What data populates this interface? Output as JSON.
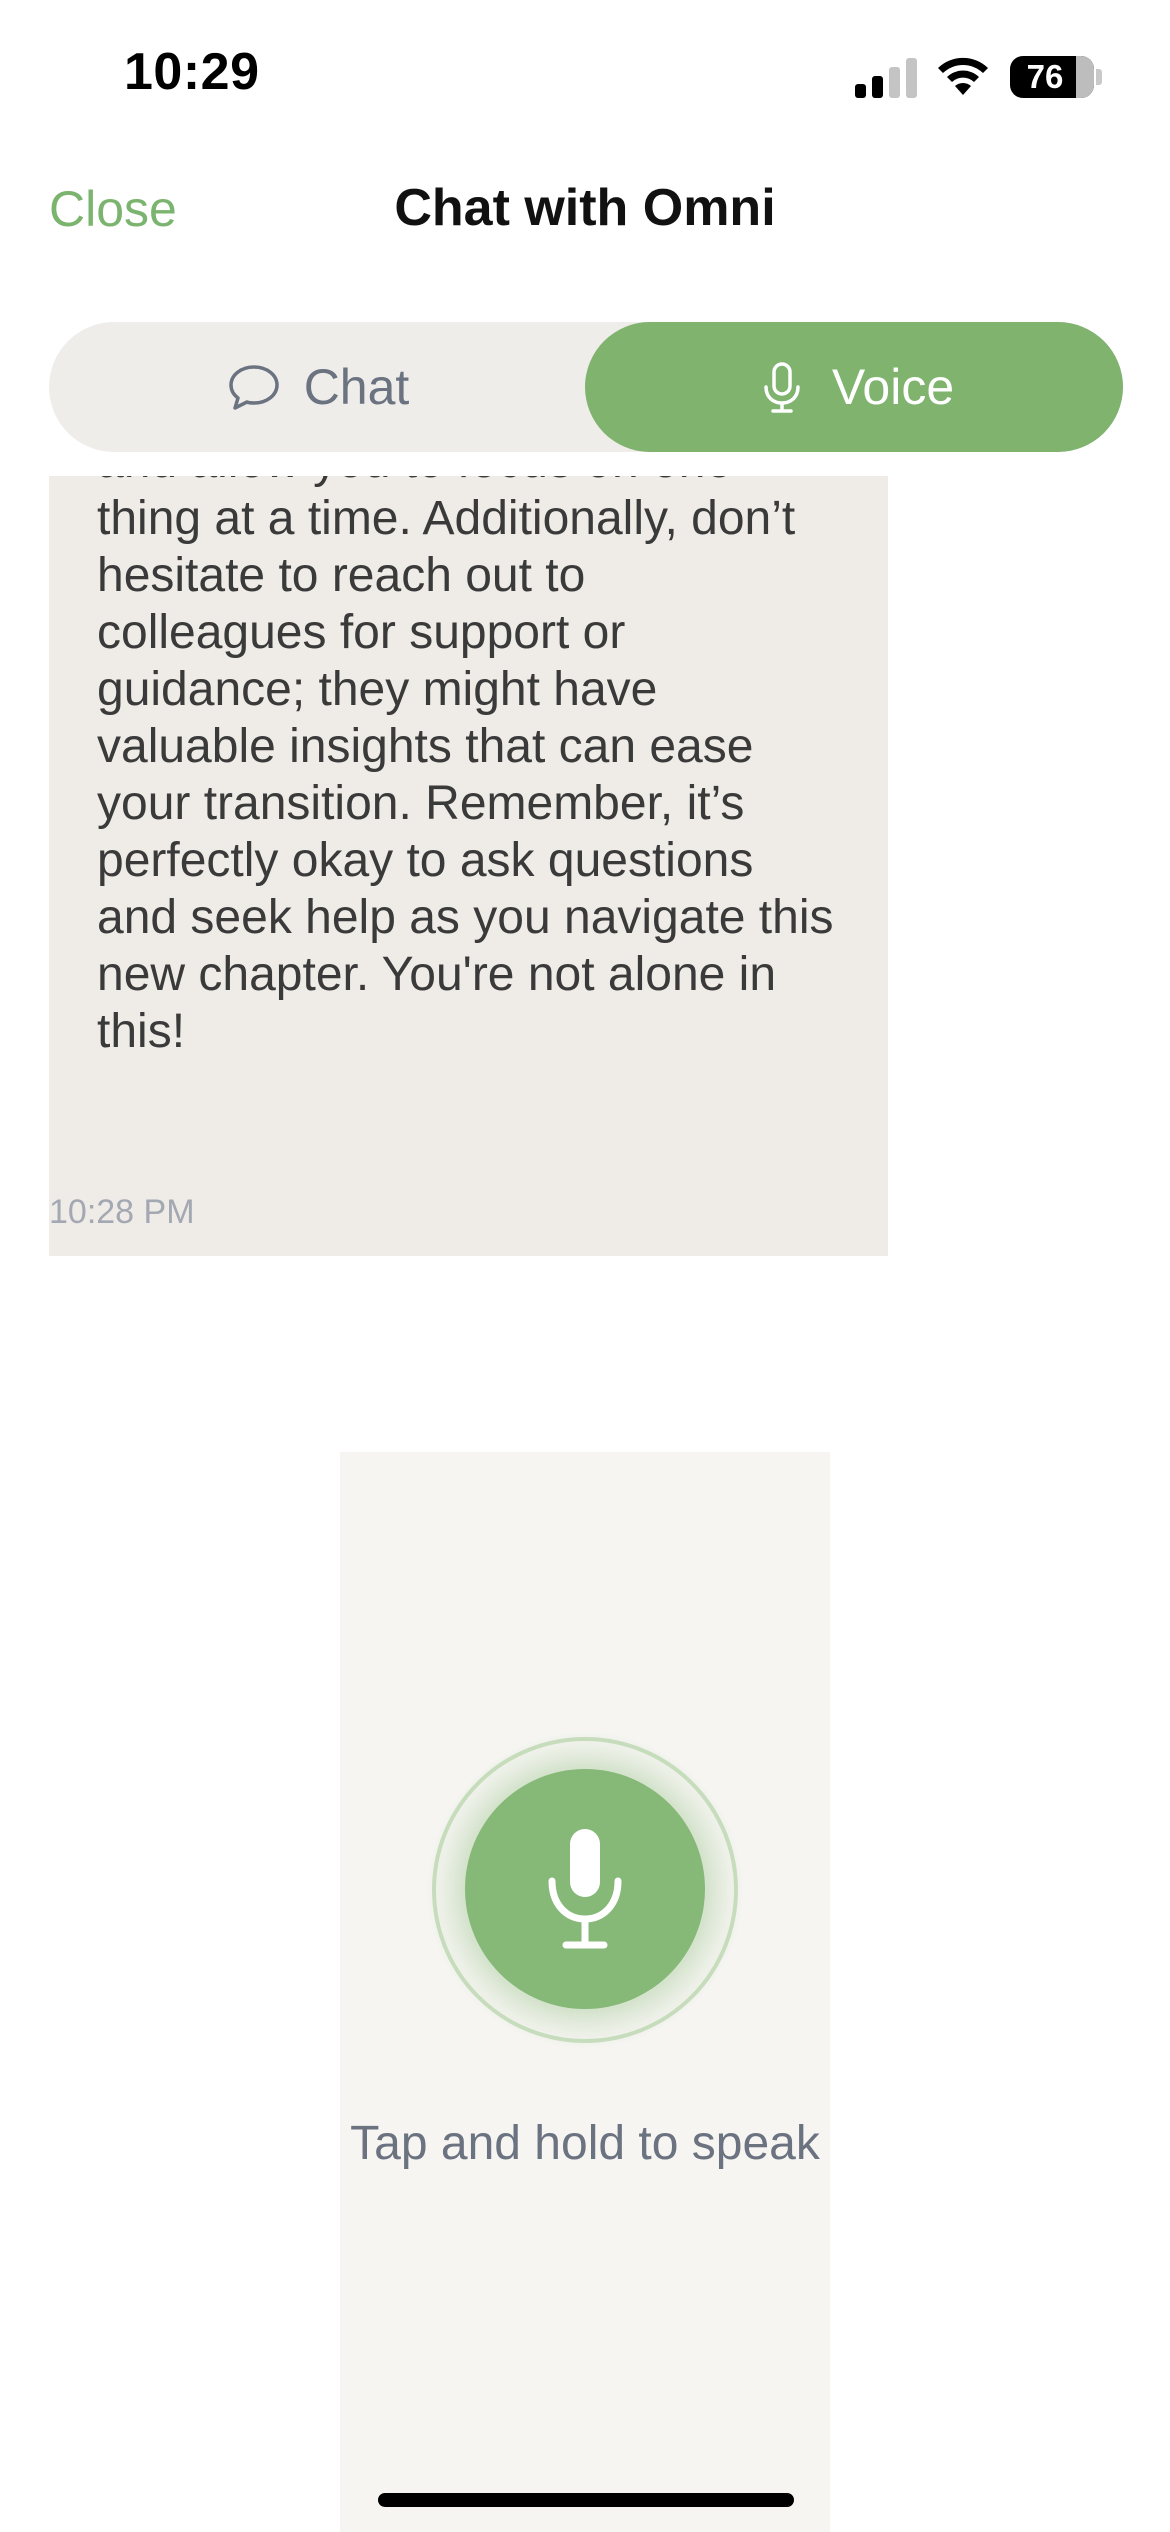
{
  "status_bar": {
    "time": "10:29",
    "battery": "76",
    "icons": [
      "signal-icon",
      "wifi-icon",
      "battery-icon"
    ]
  },
  "header": {
    "close_label": "Close",
    "title": "Chat with Omni"
  },
  "tabs": [
    {
      "label": "Chat",
      "icon": "speech-bubble-icon",
      "selected": false
    },
    {
      "label": "Voice",
      "icon": "microphone-icon",
      "selected": true
    }
  ],
  "message": {
    "text": "everything feel less overwhelming\nand allow you to focus on one\nthing at a time. Additionally, don’t\nhesitate to reach out to\ncolleagues for support or\nguidance; they might have\nvaluable insights that can ease\nyour transition. Remember, it’s\nperfectly okay to ask questions\nand seek help as you navigate this\nnew chapter. You're not alone in\nthis!",
    "timestamp": "10:28 PM"
  },
  "voice": {
    "hint": "Tap and hold to speak",
    "button_icon": "microphone-icon"
  },
  "colors": {
    "accent": "#7fb36e",
    "bubble": "#efece7",
    "panel": "#f6f5f2"
  }
}
